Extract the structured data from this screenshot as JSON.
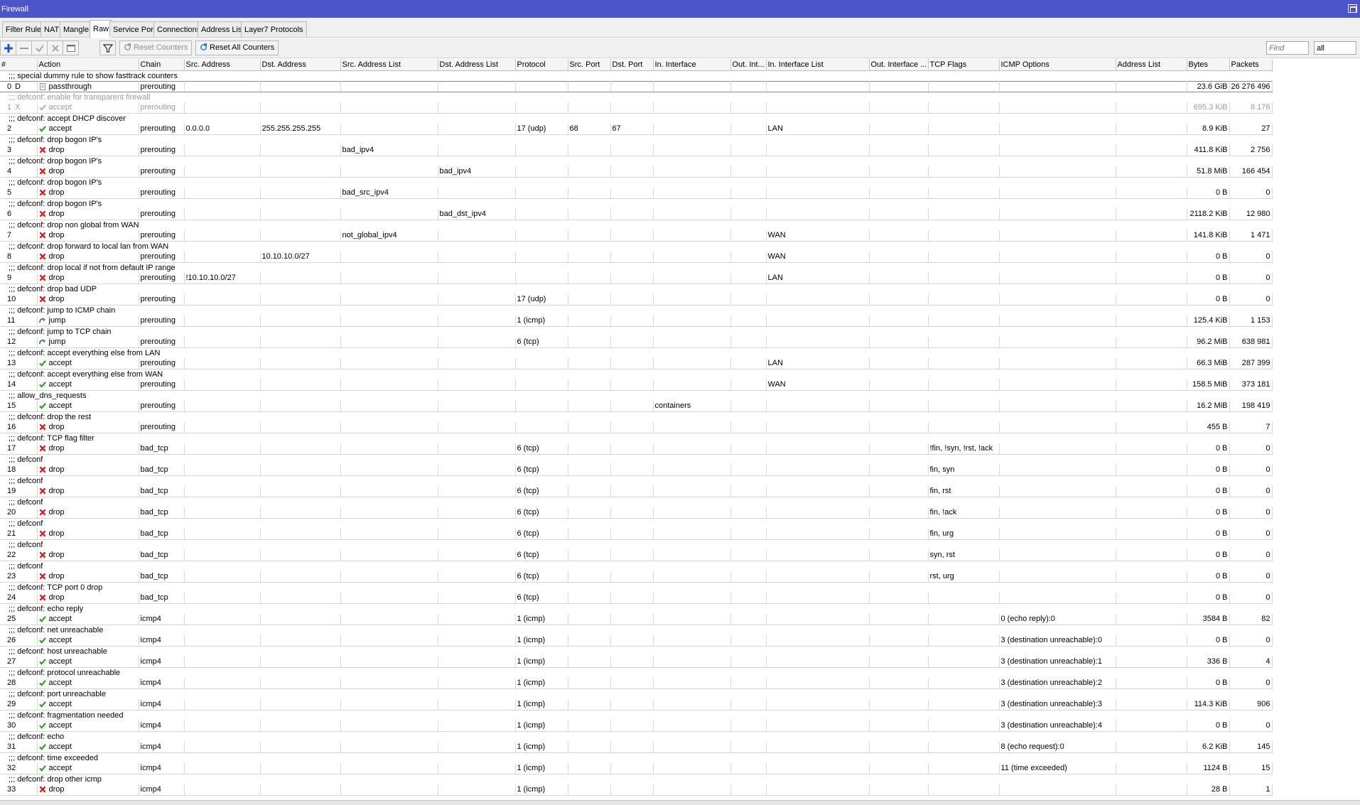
{
  "window": {
    "title": "Firewall"
  },
  "tabs": [
    {
      "label": "Filter Rules",
      "active": false
    },
    {
      "label": "NAT",
      "active": false
    },
    {
      "label": "Mangle",
      "active": false
    },
    {
      "label": "Raw",
      "active": true
    },
    {
      "label": "Service Ports",
      "active": false
    },
    {
      "label": "Connections",
      "active": false
    },
    {
      "label": "Address Lists",
      "active": false
    },
    {
      "label": "Layer7 Protocols",
      "active": false
    }
  ],
  "toolbar": {
    "reset_counters": "Reset Counters",
    "reset_all_counters": "Reset All Counters",
    "find_placeholder": "Find",
    "filter_value": "all"
  },
  "columns": [
    "#",
    "Action",
    "Chain",
    "Src. Address",
    "Dst. Address",
    "Src. Address List",
    "Dst. Address List",
    "Protocol",
    "Src. Port",
    "Dst. Port",
    "In. Interface",
    "Out. Int...",
    "In. Interface List",
    "Out. Interface ...",
    "TCP Flags",
    "ICMP Options",
    "Address List",
    "Bytes",
    "Packets"
  ],
  "rows": [
    {
      "comment": ";;; special dummy rule to show fasttrack counters",
      "num": "0",
      "flag": "D",
      "action": "passthrough",
      "chain": "prerouting",
      "bytes": "23.6 GiB",
      "packets": "26 276 496",
      "selected": true
    },
    {
      "comment": ";;; defconf: enable for transparent firewall",
      "num": "1",
      "flag": "X",
      "action": "accept",
      "chain": "prerouting",
      "bytes": "695.3 KiB",
      "packets": "8 176",
      "disabled": true
    },
    {
      "comment": ";;; defconf: accept DHCP discover",
      "num": "2",
      "action": "accept",
      "chain": "prerouting",
      "src": "0.0.0.0",
      "dst": "255.255.255.255",
      "proto": "17 (udp)",
      "sport": "68",
      "dport": "67",
      "iflist": "LAN",
      "bytes": "8.9 KiB",
      "packets": "27"
    },
    {
      "comment": ";;; defconf: drop bogon IP's",
      "num": "3",
      "action": "drop",
      "chain": "prerouting",
      "srclist": "bad_ipv4",
      "bytes": "411.8 KiB",
      "packets": "2 756"
    },
    {
      "comment": ";;; defconf: drop bogon IP's",
      "num": "4",
      "action": "drop",
      "chain": "prerouting",
      "dstlist": "bad_ipv4",
      "bytes": "51.8 MiB",
      "packets": "166 454"
    },
    {
      "comment": ";;; defconf: drop bogon IP's",
      "num": "5",
      "action": "drop",
      "chain": "prerouting",
      "srclist": "bad_src_ipv4",
      "bytes": "0 B",
      "packets": "0"
    },
    {
      "comment": ";;; defconf: drop bogon IP's",
      "num": "6",
      "action": "drop",
      "chain": "prerouting",
      "dstlist": "bad_dst_ipv4",
      "bytes": "2118.2 KiB",
      "packets": "12 980"
    },
    {
      "comment": ";;; defconf: drop non global from WAN",
      "num": "7",
      "action": "drop",
      "chain": "prerouting",
      "srclist": "not_global_ipv4",
      "iflist": "WAN",
      "bytes": "141.8 KiB",
      "packets": "1 471"
    },
    {
      "comment": ";;; defconf: drop forward to local lan from WAN",
      "num": "8",
      "action": "drop",
      "chain": "prerouting",
      "dst": "10.10.10.0/27",
      "iflist": "WAN",
      "bytes": "0 B",
      "packets": "0"
    },
    {
      "comment": ";;; defconf: drop local if not from default IP range",
      "num": "9",
      "action": "drop",
      "chain": "prerouting",
      "src": "!10.10.10.0/27",
      "iflist": "LAN",
      "bytes": "0 B",
      "packets": "0"
    },
    {
      "comment": ";;; defconf: drop bad UDP",
      "num": "10",
      "action": "drop",
      "chain": "prerouting",
      "proto": "17 (udp)",
      "bytes": "0 B",
      "packets": "0"
    },
    {
      "comment": ";;; defconf: jump to ICMP chain",
      "num": "11",
      "action": "jump",
      "chain": "prerouting",
      "proto": "1 (icmp)",
      "bytes": "125.4 KiB",
      "packets": "1 153"
    },
    {
      "comment": ";;; defconf: jump to TCP chain",
      "num": "12",
      "action": "jump",
      "chain": "prerouting",
      "proto": "6 (tcp)",
      "bytes": "96.2 MiB",
      "packets": "638 981"
    },
    {
      "comment": ";;; defconf: accept everything else from LAN",
      "num": "13",
      "action": "accept",
      "chain": "prerouting",
      "iflist": "LAN",
      "bytes": "66.3 MiB",
      "packets": "287 399"
    },
    {
      "comment": ";;; defconf: accept everything else from WAN",
      "num": "14",
      "action": "accept",
      "chain": "prerouting",
      "iflist": "WAN",
      "bytes": "158.5 MiB",
      "packets": "373 181"
    },
    {
      "comment": ";;; allow_dns_requests",
      "num": "15",
      "action": "accept",
      "chain": "prerouting",
      "inif": "containers",
      "bytes": "16.2 MiB",
      "packets": "198 419"
    },
    {
      "comment": ";;; defconf: drop the rest",
      "num": "16",
      "action": "drop",
      "chain": "prerouting",
      "bytes": "455 B",
      "packets": "7"
    },
    {
      "comment": ";;; defconf: TCP flag filter",
      "num": "17",
      "action": "drop",
      "chain": "bad_tcp",
      "proto": "6 (tcp)",
      "tcpflags": "!fin, !syn, !rst, !ack",
      "bytes": "0 B",
      "packets": "0"
    },
    {
      "comment": ";;; defconf",
      "num": "18",
      "action": "drop",
      "chain": "bad_tcp",
      "proto": "6 (tcp)",
      "tcpflags": "fin, syn",
      "bytes": "0 B",
      "packets": "0"
    },
    {
      "comment": ";;; defconf",
      "num": "19",
      "action": "drop",
      "chain": "bad_tcp",
      "proto": "6 (tcp)",
      "tcpflags": "fin, rst",
      "bytes": "0 B",
      "packets": "0"
    },
    {
      "comment": ";;; defconf",
      "num": "20",
      "action": "drop",
      "chain": "bad_tcp",
      "proto": "6 (tcp)",
      "tcpflags": "fin, !ack",
      "bytes": "0 B",
      "packets": "0"
    },
    {
      "comment": ";;; defconf",
      "num": "21",
      "action": "drop",
      "chain": "bad_tcp",
      "proto": "6 (tcp)",
      "tcpflags": "fin, urg",
      "bytes": "0 B",
      "packets": "0"
    },
    {
      "comment": ";;; defconf",
      "num": "22",
      "action": "drop",
      "chain": "bad_tcp",
      "proto": "6 (tcp)",
      "tcpflags": "syn, rst",
      "bytes": "0 B",
      "packets": "0"
    },
    {
      "comment": ";;; defconf",
      "num": "23",
      "action": "drop",
      "chain": "bad_tcp",
      "proto": "6 (tcp)",
      "tcpflags": "rst, urg",
      "bytes": "0 B",
      "packets": "0"
    },
    {
      "comment": ";;; defconf: TCP port 0 drop",
      "num": "24",
      "action": "drop",
      "chain": "bad_tcp",
      "proto": "6 (tcp)",
      "bytes": "0 B",
      "packets": "0"
    },
    {
      "comment": ";;; defconf: echo reply",
      "num": "25",
      "action": "accept",
      "chain": "icmp4",
      "proto": "1 (icmp)",
      "icmp": "0 (echo reply):0",
      "bytes": "3584 B",
      "packets": "82"
    },
    {
      "comment": ";;; defconf: net unreachable",
      "num": "26",
      "action": "accept",
      "chain": "icmp4",
      "proto": "1 (icmp)",
      "icmp": "3 (destination unreachable):0",
      "bytes": "0 B",
      "packets": "0"
    },
    {
      "comment": ";;; defconf: host unreachable",
      "num": "27",
      "action": "accept",
      "chain": "icmp4",
      "proto": "1 (icmp)",
      "icmp": "3 (destination unreachable):1",
      "bytes": "336 B",
      "packets": "4"
    },
    {
      "comment": ";;; defconf: protocol unreachable",
      "num": "28",
      "action": "accept",
      "chain": "icmp4",
      "proto": "1 (icmp)",
      "icmp": "3 (destination unreachable):2",
      "bytes": "0 B",
      "packets": "0"
    },
    {
      "comment": ";;; defconf: port unreachable",
      "num": "29",
      "action": "accept",
      "chain": "icmp4",
      "proto": "1 (icmp)",
      "icmp": "3 (destination unreachable):3",
      "bytes": "114.3 KiB",
      "packets": "906"
    },
    {
      "comment": ";;; defconf: fragmentation needed",
      "num": "30",
      "action": "accept",
      "chain": "icmp4",
      "proto": "1 (icmp)",
      "icmp": "3 (destination unreachable):4",
      "bytes": "0 B",
      "packets": "0"
    },
    {
      "comment": ";;; defconf: echo",
      "num": "31",
      "action": "accept",
      "chain": "icmp4",
      "proto": "1 (icmp)",
      "icmp": "8 (echo request):0",
      "bytes": "6.2 KiB",
      "packets": "145"
    },
    {
      "comment": ";;; defconf: time exceeded",
      "num": "32",
      "action": "accept",
      "chain": "icmp4",
      "proto": "1 (icmp)",
      "icmp": "11 (time exceeded)",
      "bytes": "1124 B",
      "packets": "15"
    },
    {
      "comment": ";;; defconf: drop other icmp",
      "num": "33",
      "action": "drop",
      "chain": "icmp4",
      "proto": "1 (icmp)",
      "bytes": "28 B",
      "packets": "1"
    }
  ],
  "colors": {
    "titlebar": "#4c56c9",
    "accept": "#2e9e1f",
    "drop": "#d82020",
    "jump": "#2a78c2"
  }
}
